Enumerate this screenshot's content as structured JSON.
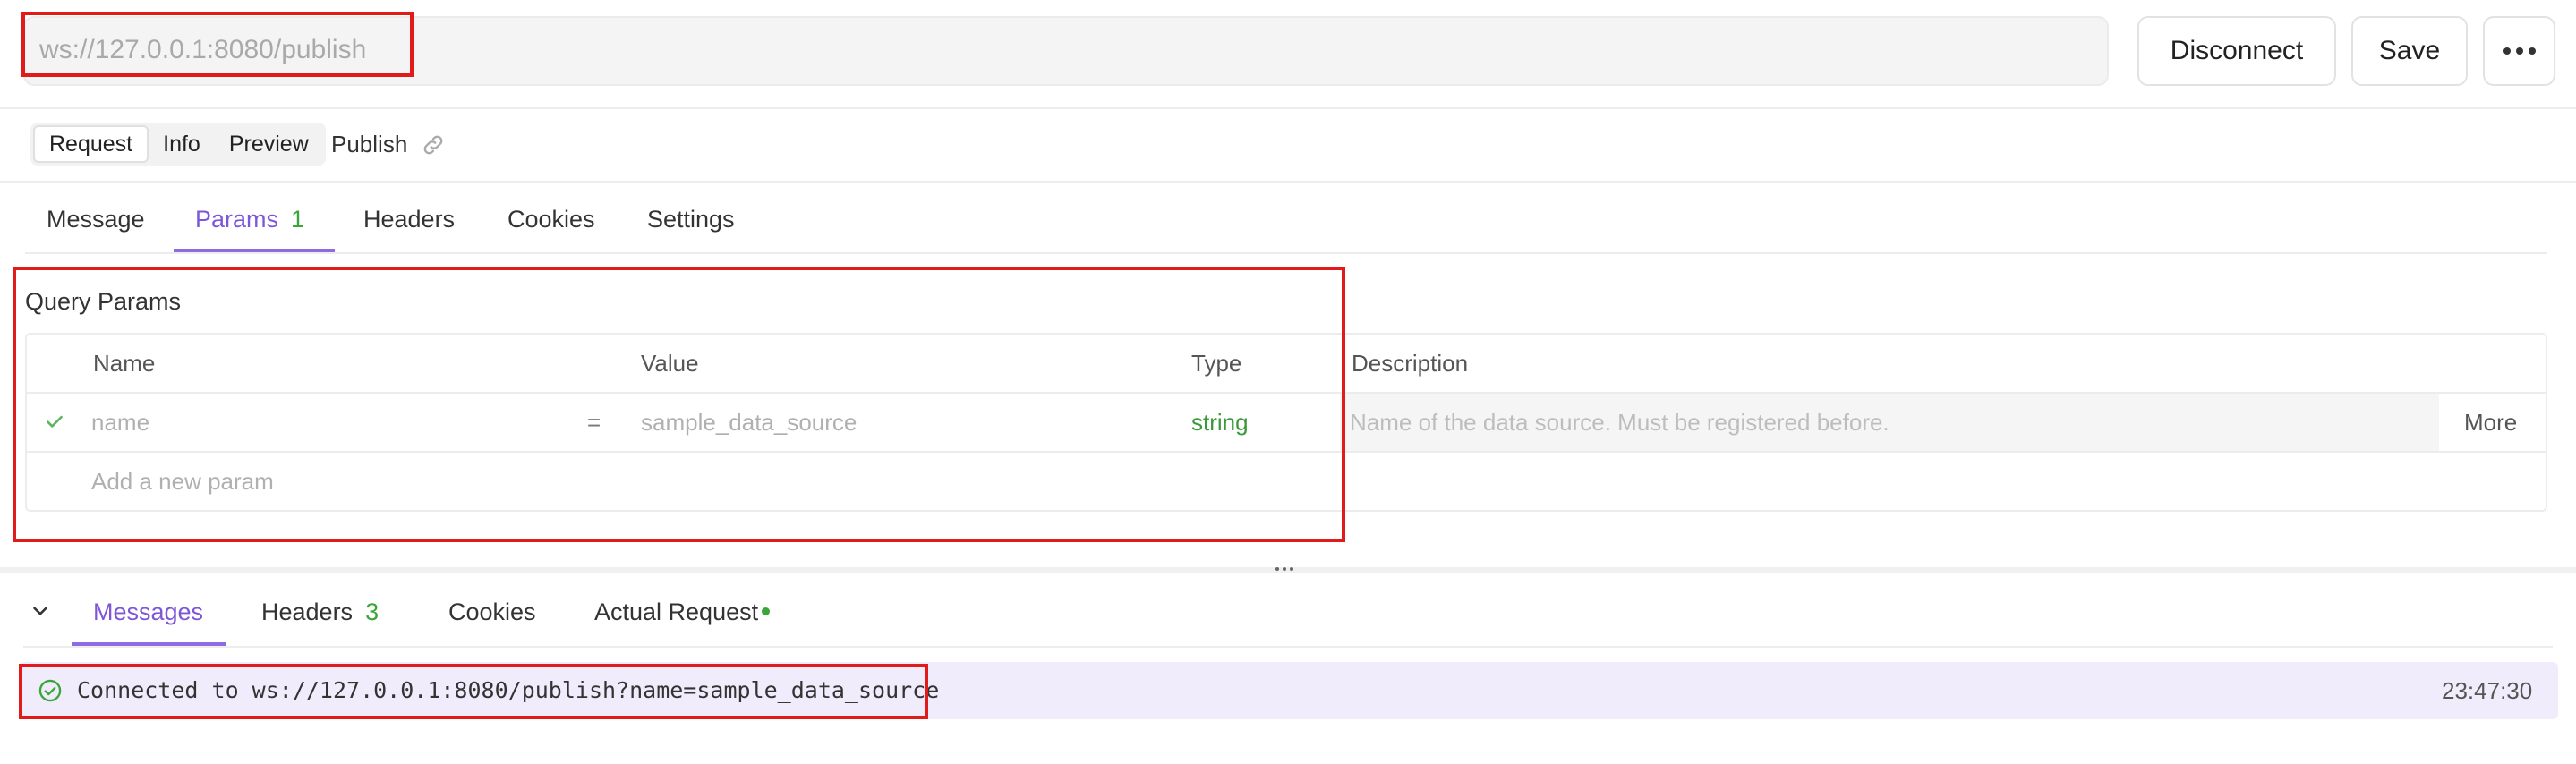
{
  "url": {
    "value": "ws://127.0.0.1:8080/publish"
  },
  "toolbar": {
    "disconnect_label": "Disconnect",
    "save_label": "Save",
    "more_icon": "ellipsis-icon"
  },
  "mode_switch": {
    "items": [
      "Request",
      "Info",
      "Preview"
    ],
    "active": "Request",
    "publish_label": "Publish",
    "link_icon": "link-icon"
  },
  "request_tabs": {
    "message": "Message",
    "params": "Params",
    "params_count": "1",
    "headers": "Headers",
    "cookies": "Cookies",
    "settings": "Settings",
    "active": "Params"
  },
  "query_params": {
    "title": "Query Params",
    "columns": {
      "name": "Name",
      "value": "Value",
      "type": "Type",
      "description": "Description"
    },
    "rows": [
      {
        "enabled": true,
        "name": "name",
        "equals": "=",
        "value": "sample_data_source",
        "type": "string",
        "description": "Name of the data source. Must be registered before.",
        "more": "More"
      }
    ],
    "add_placeholder": "Add a new param"
  },
  "response_tabs": {
    "messages": "Messages",
    "headers": "Headers",
    "headers_count": "3",
    "cookies": "Cookies",
    "actual_request": "Actual Request",
    "active": "Messages"
  },
  "messages": [
    {
      "icon": "check-circle-icon",
      "text": "Connected to ws://127.0.0.1:8080/publish?name=sample_data_source",
      "time": "23:47:30"
    }
  ],
  "colors": {
    "accent": "#7e57d8",
    "success": "#3aa63a",
    "highlight": "#e11a1a"
  }
}
